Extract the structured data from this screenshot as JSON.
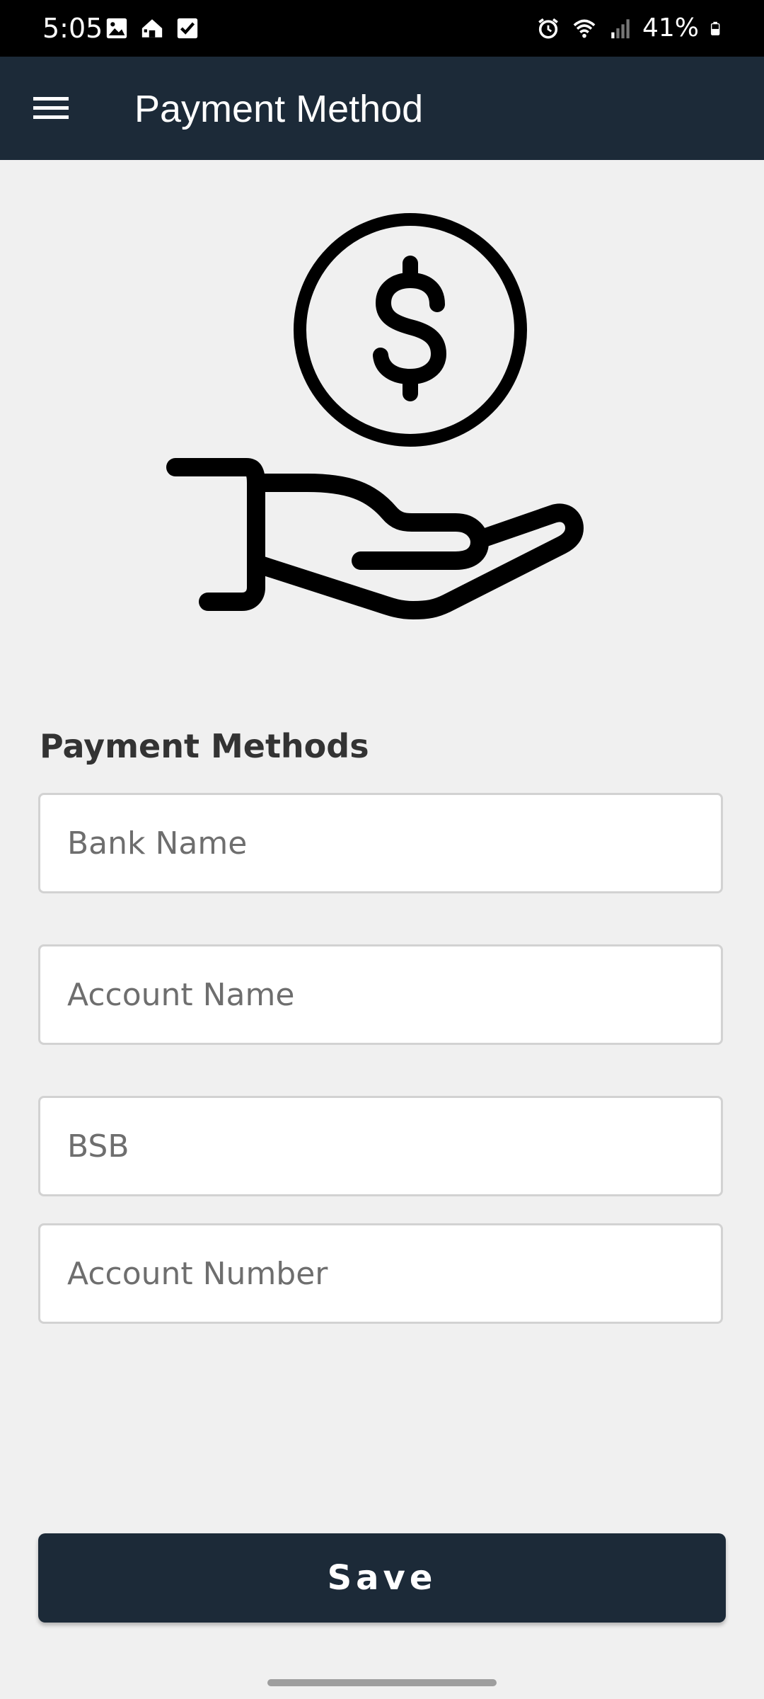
{
  "status_bar": {
    "time": "5:05",
    "battery": "41%",
    "left_icons": [
      "gallery-icon",
      "home-icon",
      "checkbox-icon"
    ],
    "right_icons": [
      "alarm-icon",
      "wifi-icon",
      "signal-icon",
      "battery-icon"
    ]
  },
  "app_bar": {
    "title": "Payment Method",
    "menu_icon": "hamburger-menu-icon",
    "background": "#1c2a38"
  },
  "hero": {
    "icon": "hand-holding-dollar-icon"
  },
  "form": {
    "section_title": "Payment Methods",
    "fields": {
      "bank_name": {
        "placeholder": "Bank Name",
        "value": ""
      },
      "account_name": {
        "placeholder": "Account Name",
        "value": ""
      },
      "bsb": {
        "placeholder": "BSB",
        "value": ""
      },
      "account_number": {
        "placeholder": "Account Number",
        "value": ""
      }
    }
  },
  "actions": {
    "save_label": "Save"
  },
  "colors": {
    "primary": "#1c2a38",
    "background": "#f0f0f0",
    "field_border": "#d2d2d2"
  }
}
